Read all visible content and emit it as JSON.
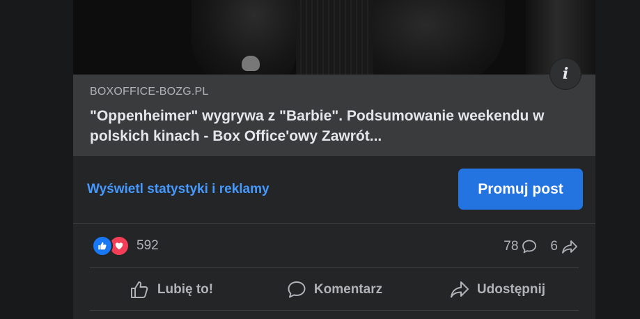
{
  "post": {
    "info_icon_glyph": "i",
    "link": {
      "domain": "BOXOFFICE-BOZG.PL",
      "headline": "\"Oppenheimer\" wygrywa z \"Barbie\". Podsumowanie weekendu w polskich kinach - Box Office'owy Zawrót..."
    },
    "stats_link": "Wyświetl statystyki i reklamy",
    "promote_button": "Promuj post",
    "reactions": {
      "icons": [
        "like-icon",
        "love-icon"
      ],
      "count": "592"
    },
    "comments_count": "78",
    "shares_count": "6",
    "actions": {
      "like": "Lubię to!",
      "comment": "Komentarz",
      "share": "Udostępnij"
    }
  },
  "colors": {
    "page_bg": "#18191a",
    "card_bg": "#242526",
    "link_box_bg": "#3a3b3c",
    "accent_link": "#4599ff",
    "primary_button": "#2374e1",
    "like_blue": "#1877f2",
    "love_red": "#f33e58",
    "secondary_text": "#b0b3b8",
    "primary_text": "#e4e6eb"
  }
}
